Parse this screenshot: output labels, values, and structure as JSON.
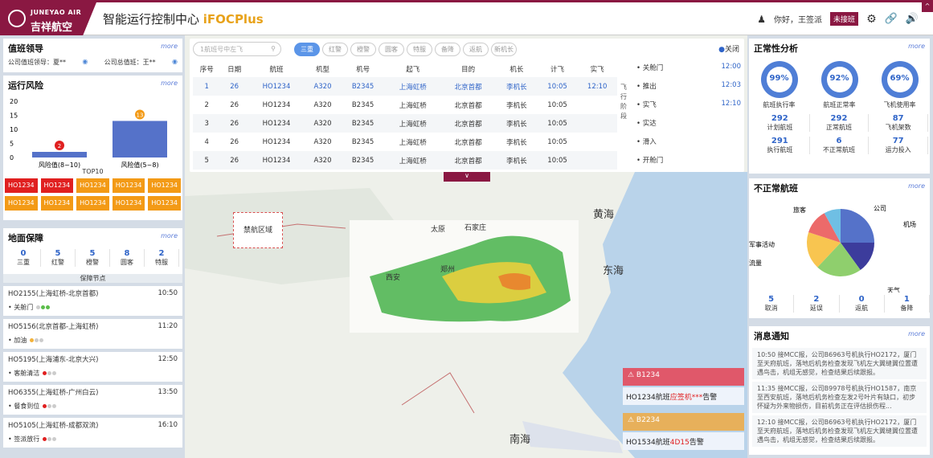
{
  "header": {
    "logo_en": "JUNEYAO AIR",
    "logo_cn": "吉祥航空",
    "title": "智能运行控制中心 ",
    "title_brand": "iFOC",
    "title_plus": "Plus",
    "greeting": "你好，王签派",
    "shift_badge": "未接班",
    "corner": "^"
  },
  "duty": {
    "title": "值班领导",
    "more": "more",
    "company_duty": "公司值班领导：夏**",
    "company_chief": "公司总值班：王**"
  },
  "risk": {
    "title": "运行风险",
    "more": "more",
    "y_ticks": [
      "20",
      "15",
      "10",
      "5",
      "0"
    ],
    "top_label": "TOP10",
    "chart_data": {
      "type": "bar",
      "categories": [
        "风险值(8~10)",
        "风险值(5~8)"
      ],
      "values": [
        2,
        13
      ],
      "ylim": [
        0,
        20
      ]
    },
    "top10": [
      "HO1234",
      "HO1234",
      "HO1234",
      "HO1234",
      "HO1234",
      "HO1234",
      "HO1234",
      "HO1234",
      "HO1234",
      "HO1234"
    ],
    "top10_colors": [
      "#e02020",
      "#e02020",
      "#f39a16",
      "#f39a16",
      "#f39a16",
      "#f39a16",
      "#f39a16",
      "#f39a16",
      "#f39a16",
      "#f39a16"
    ]
  },
  "ground": {
    "title": "地面保障",
    "more": "more",
    "stats": [
      {
        "n": "0",
        "l": "三重"
      },
      {
        "n": "5",
        "l": "红警"
      },
      {
        "n": "5",
        "l": "橙警"
      },
      {
        "n": "8",
        "l": "圆客"
      },
      {
        "n": "2",
        "l": "特服"
      }
    ],
    "nodes_title": "保障节点",
    "items": [
      {
        "flight": "HO2155(上海虹桥-北京首都)",
        "time": "10:50",
        "status": "关舱门"
      },
      {
        "flight": "HO5156(北京首都-上海虹桥)",
        "time": "11:20",
        "status": "加油"
      },
      {
        "flight": "HO5195(上海浦东-北京大兴)",
        "time": "12:50",
        "status": "客舱清洁"
      },
      {
        "flight": "HO6355(上海虹桥-广州白云)",
        "time": "13:50",
        "status": "餐食到位"
      },
      {
        "flight": "HO5105(上海虹桥-成都双流)",
        "time": "16:10",
        "status": "签派放行"
      }
    ]
  },
  "search": {
    "placeholder": "1航班号中左飞",
    "close": "关闭"
  },
  "filters": [
    "三重",
    "红警",
    "橙警",
    "圆客",
    "特服",
    "备降",
    "返航",
    "新机长"
  ],
  "table": {
    "headers": [
      "序号",
      "日期",
      "航班",
      "机型",
      "机号",
      "起飞",
      "目的",
      "机长",
      "计飞",
      "实飞"
    ],
    "rows": [
      [
        "1",
        "26",
        "HO1234",
        "A320",
        "B2345",
        "上海虹桥",
        "北京首都",
        "李机长",
        "10:05",
        "12:10"
      ],
      [
        "2",
        "26",
        "HO1234",
        "A320",
        "B2345",
        "上海虹桥",
        "北京首都",
        "李机长",
        "10:05",
        ""
      ],
      [
        "3",
        "26",
        "HO1234",
        "A320",
        "B2345",
        "上海虹桥",
        "北京首都",
        "李机长",
        "10:05",
        ""
      ],
      [
        "4",
        "26",
        "HO1234",
        "A320",
        "B2345",
        "上海虹桥",
        "北京首都",
        "李机长",
        "10:05",
        ""
      ],
      [
        "5",
        "26",
        "HO1234",
        "A320",
        "B2345",
        "上海虹桥",
        "北京首都",
        "李机长",
        "10:05",
        ""
      ]
    ]
  },
  "phase": {
    "label": "飞行阶段",
    "steps": [
      {
        "name": "关舱门",
        "time": "12:00"
      },
      {
        "name": "推出",
        "time": "12:03"
      },
      {
        "name": "实飞",
        "time": "12:10"
      },
      {
        "name": "实达",
        "time": ""
      },
      {
        "name": "滑入",
        "time": ""
      },
      {
        "name": "开舱门",
        "time": ""
      }
    ]
  },
  "map": {
    "no_fly": "禁航区域",
    "labels": [
      "黄海",
      "东海",
      "南海",
      "太原",
      "石家庄",
      "西安",
      "郑州"
    ],
    "alerts": [
      {
        "id": "B1234",
        "msg_a": "HO1234航班",
        "msg_b": "应签机***",
        "msg_c": "告警"
      },
      {
        "id": "B2234",
        "msg_a": "HO1534航班",
        "msg_b": "4D15",
        "msg_c": "告警"
      }
    ]
  },
  "normal": {
    "title": "正常性分析",
    "more": "more",
    "gauges": [
      {
        "v": "99%",
        "l": "航班执行率"
      },
      {
        "v": "92%",
        "l": "航班正常率"
      },
      {
        "v": "69%",
        "l": "飞机使用率"
      }
    ],
    "stats": [
      {
        "n": "292",
        "l": "计划航班"
      },
      {
        "n": "292",
        "l": "正常航班"
      },
      {
        "n": "87",
        "l": "飞机架数"
      },
      {
        "n": "291",
        "l": "执行航班"
      },
      {
        "n": "6",
        "l": "不正常航班"
      },
      {
        "n": "77",
        "l": "运力投入"
      }
    ]
  },
  "abnormal": {
    "title": "不正常航班",
    "more": "more",
    "chart_data": {
      "type": "pie",
      "labels": [
        "公司",
        "机场",
        "天气",
        "流量",
        "军事活动",
        "旅客"
      ],
      "values": [
        25,
        15,
        22,
        18,
        12,
        8
      ],
      "colors": [
        "#5572c9",
        "#3c3c9c",
        "#8fcf6d",
        "#f8c550",
        "#ec6a6a",
        "#6fbfe4"
      ]
    },
    "pie_labels": [
      "旅客",
      "公司",
      "机场",
      "军事活动",
      "流量",
      "天气"
    ],
    "stats": [
      {
        "n": "5",
        "l": "取消"
      },
      {
        "n": "2",
        "l": "延误"
      },
      {
        "n": "0",
        "l": "返航"
      },
      {
        "n": "1",
        "l": "备降"
      }
    ]
  },
  "news": {
    "title": "消息通知",
    "more": "more",
    "items": [
      "10:50 接MCC报，公司B6963号机执行HO2172，厦门至天府航班，落地后机务检查发现飞机左大翼缝翼位置遭遇鸟击，机组无感觉，检查结果后续跟报。",
      "11:35 接MCC报，公司B9978号机执行HO1587，南京至西安航班，落地后机务检查左发2号叶片有缺口，初步怀疑为外来物损伤，目前机务正在评估损伤程...",
      "12:10 接MCC报，公司B6963号机执行HO2172，厦门至天府航班，落地后机务检查发现飞机左大翼缝翼位置遭遇鸟击，机组无感觉，检查结果后续跟报。"
    ]
  }
}
